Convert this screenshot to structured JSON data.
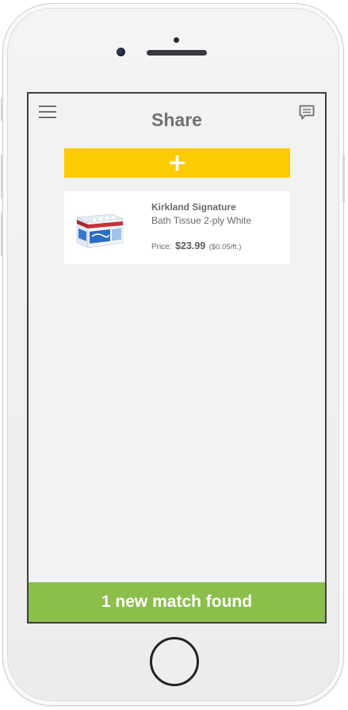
{
  "header": {
    "title": "Share",
    "menu_icon": "hamburger-menu-icon",
    "chat_icon": "chat-icon"
  },
  "actions": {
    "add_label": "+",
    "add_color": "#fdcb02"
  },
  "product": {
    "brand": "Kirkland Signature",
    "name": "Bath Tissue 2-ply White",
    "price_label": "Price:",
    "price": "$23.99",
    "unit_price": "($0.05/ft.)",
    "thumbnail_icon": "bath-tissue-package-image"
  },
  "footer": {
    "match_text": "1 new match found",
    "color": "#8bbe4b"
  },
  "colors": {
    "screen_background": "#f1f2f2",
    "text": "#6a6a6a"
  }
}
